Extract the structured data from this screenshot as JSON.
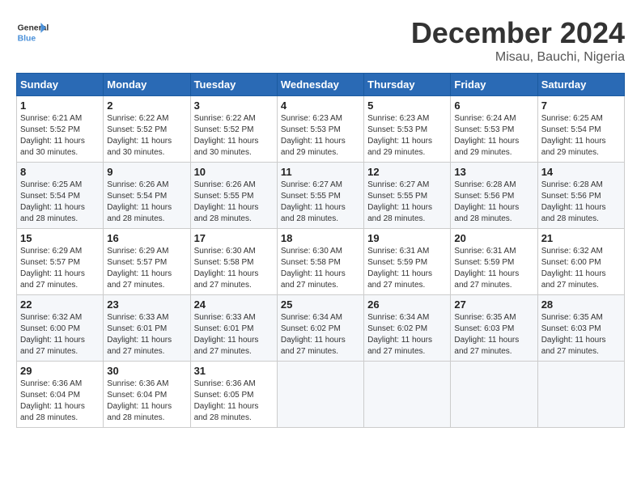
{
  "header": {
    "logo_text_general": "General",
    "logo_text_blue": "Blue",
    "month_title": "December 2024",
    "location": "Misau, Bauchi, Nigeria"
  },
  "calendar": {
    "days_of_week": [
      "Sunday",
      "Monday",
      "Tuesday",
      "Wednesday",
      "Thursday",
      "Friday",
      "Saturday"
    ],
    "weeks": [
      [
        null,
        null,
        null,
        null,
        null,
        null,
        null
      ]
    ],
    "cells": [
      {
        "day": "",
        "info": ""
      },
      {
        "day": "",
        "info": ""
      },
      {
        "day": "",
        "info": ""
      },
      {
        "day": "",
        "info": ""
      },
      {
        "day": "",
        "info": ""
      },
      {
        "day": "",
        "info": ""
      },
      {
        "day": "",
        "info": ""
      }
    ]
  },
  "days": [
    {
      "num": "1",
      "sunrise": "6:21 AM",
      "sunset": "5:52 PM",
      "daylight": "11 hours and 30 minutes."
    },
    {
      "num": "2",
      "sunrise": "6:22 AM",
      "sunset": "5:52 PM",
      "daylight": "11 hours and 30 minutes."
    },
    {
      "num": "3",
      "sunrise": "6:22 AM",
      "sunset": "5:52 PM",
      "daylight": "11 hours and 30 minutes."
    },
    {
      "num": "4",
      "sunrise": "6:23 AM",
      "sunset": "5:53 PM",
      "daylight": "11 hours and 29 minutes."
    },
    {
      "num": "5",
      "sunrise": "6:23 AM",
      "sunset": "5:53 PM",
      "daylight": "11 hours and 29 minutes."
    },
    {
      "num": "6",
      "sunrise": "6:24 AM",
      "sunset": "5:53 PM",
      "daylight": "11 hours and 29 minutes."
    },
    {
      "num": "7",
      "sunrise": "6:25 AM",
      "sunset": "5:54 PM",
      "daylight": "11 hours and 29 minutes."
    },
    {
      "num": "8",
      "sunrise": "6:25 AM",
      "sunset": "5:54 PM",
      "daylight": "11 hours and 28 minutes."
    },
    {
      "num": "9",
      "sunrise": "6:26 AM",
      "sunset": "5:54 PM",
      "daylight": "11 hours and 28 minutes."
    },
    {
      "num": "10",
      "sunrise": "6:26 AM",
      "sunset": "5:55 PM",
      "daylight": "11 hours and 28 minutes."
    },
    {
      "num": "11",
      "sunrise": "6:27 AM",
      "sunset": "5:55 PM",
      "daylight": "11 hours and 28 minutes."
    },
    {
      "num": "12",
      "sunrise": "6:27 AM",
      "sunset": "5:55 PM",
      "daylight": "11 hours and 28 minutes."
    },
    {
      "num": "13",
      "sunrise": "6:28 AM",
      "sunset": "5:56 PM",
      "daylight": "11 hours and 28 minutes."
    },
    {
      "num": "14",
      "sunrise": "6:28 AM",
      "sunset": "5:56 PM",
      "daylight": "11 hours and 28 minutes."
    },
    {
      "num": "15",
      "sunrise": "6:29 AM",
      "sunset": "5:57 PM",
      "daylight": "11 hours and 27 minutes."
    },
    {
      "num": "16",
      "sunrise": "6:29 AM",
      "sunset": "5:57 PM",
      "daylight": "11 hours and 27 minutes."
    },
    {
      "num": "17",
      "sunrise": "6:30 AM",
      "sunset": "5:58 PM",
      "daylight": "11 hours and 27 minutes."
    },
    {
      "num": "18",
      "sunrise": "6:30 AM",
      "sunset": "5:58 PM",
      "daylight": "11 hours and 27 minutes."
    },
    {
      "num": "19",
      "sunrise": "6:31 AM",
      "sunset": "5:59 PM",
      "daylight": "11 hours and 27 minutes."
    },
    {
      "num": "20",
      "sunrise": "6:31 AM",
      "sunset": "5:59 PM",
      "daylight": "11 hours and 27 minutes."
    },
    {
      "num": "21",
      "sunrise": "6:32 AM",
      "sunset": "6:00 PM",
      "daylight": "11 hours and 27 minutes."
    },
    {
      "num": "22",
      "sunrise": "6:32 AM",
      "sunset": "6:00 PM",
      "daylight": "11 hours and 27 minutes."
    },
    {
      "num": "23",
      "sunrise": "6:33 AM",
      "sunset": "6:01 PM",
      "daylight": "11 hours and 27 minutes."
    },
    {
      "num": "24",
      "sunrise": "6:33 AM",
      "sunset": "6:01 PM",
      "daylight": "11 hours and 27 minutes."
    },
    {
      "num": "25",
      "sunrise": "6:34 AM",
      "sunset": "6:02 PM",
      "daylight": "11 hours and 27 minutes."
    },
    {
      "num": "26",
      "sunrise": "6:34 AM",
      "sunset": "6:02 PM",
      "daylight": "11 hours and 27 minutes."
    },
    {
      "num": "27",
      "sunrise": "6:35 AM",
      "sunset": "6:03 PM",
      "daylight": "11 hours and 27 minutes."
    },
    {
      "num": "28",
      "sunrise": "6:35 AM",
      "sunset": "6:03 PM",
      "daylight": "11 hours and 27 minutes."
    },
    {
      "num": "29",
      "sunrise": "6:36 AM",
      "sunset": "6:04 PM",
      "daylight": "11 hours and 28 minutes."
    },
    {
      "num": "30",
      "sunrise": "6:36 AM",
      "sunset": "6:04 PM",
      "daylight": "11 hours and 28 minutes."
    },
    {
      "num": "31",
      "sunrise": "6:36 AM",
      "sunset": "6:05 PM",
      "daylight": "11 hours and 28 minutes."
    }
  ]
}
